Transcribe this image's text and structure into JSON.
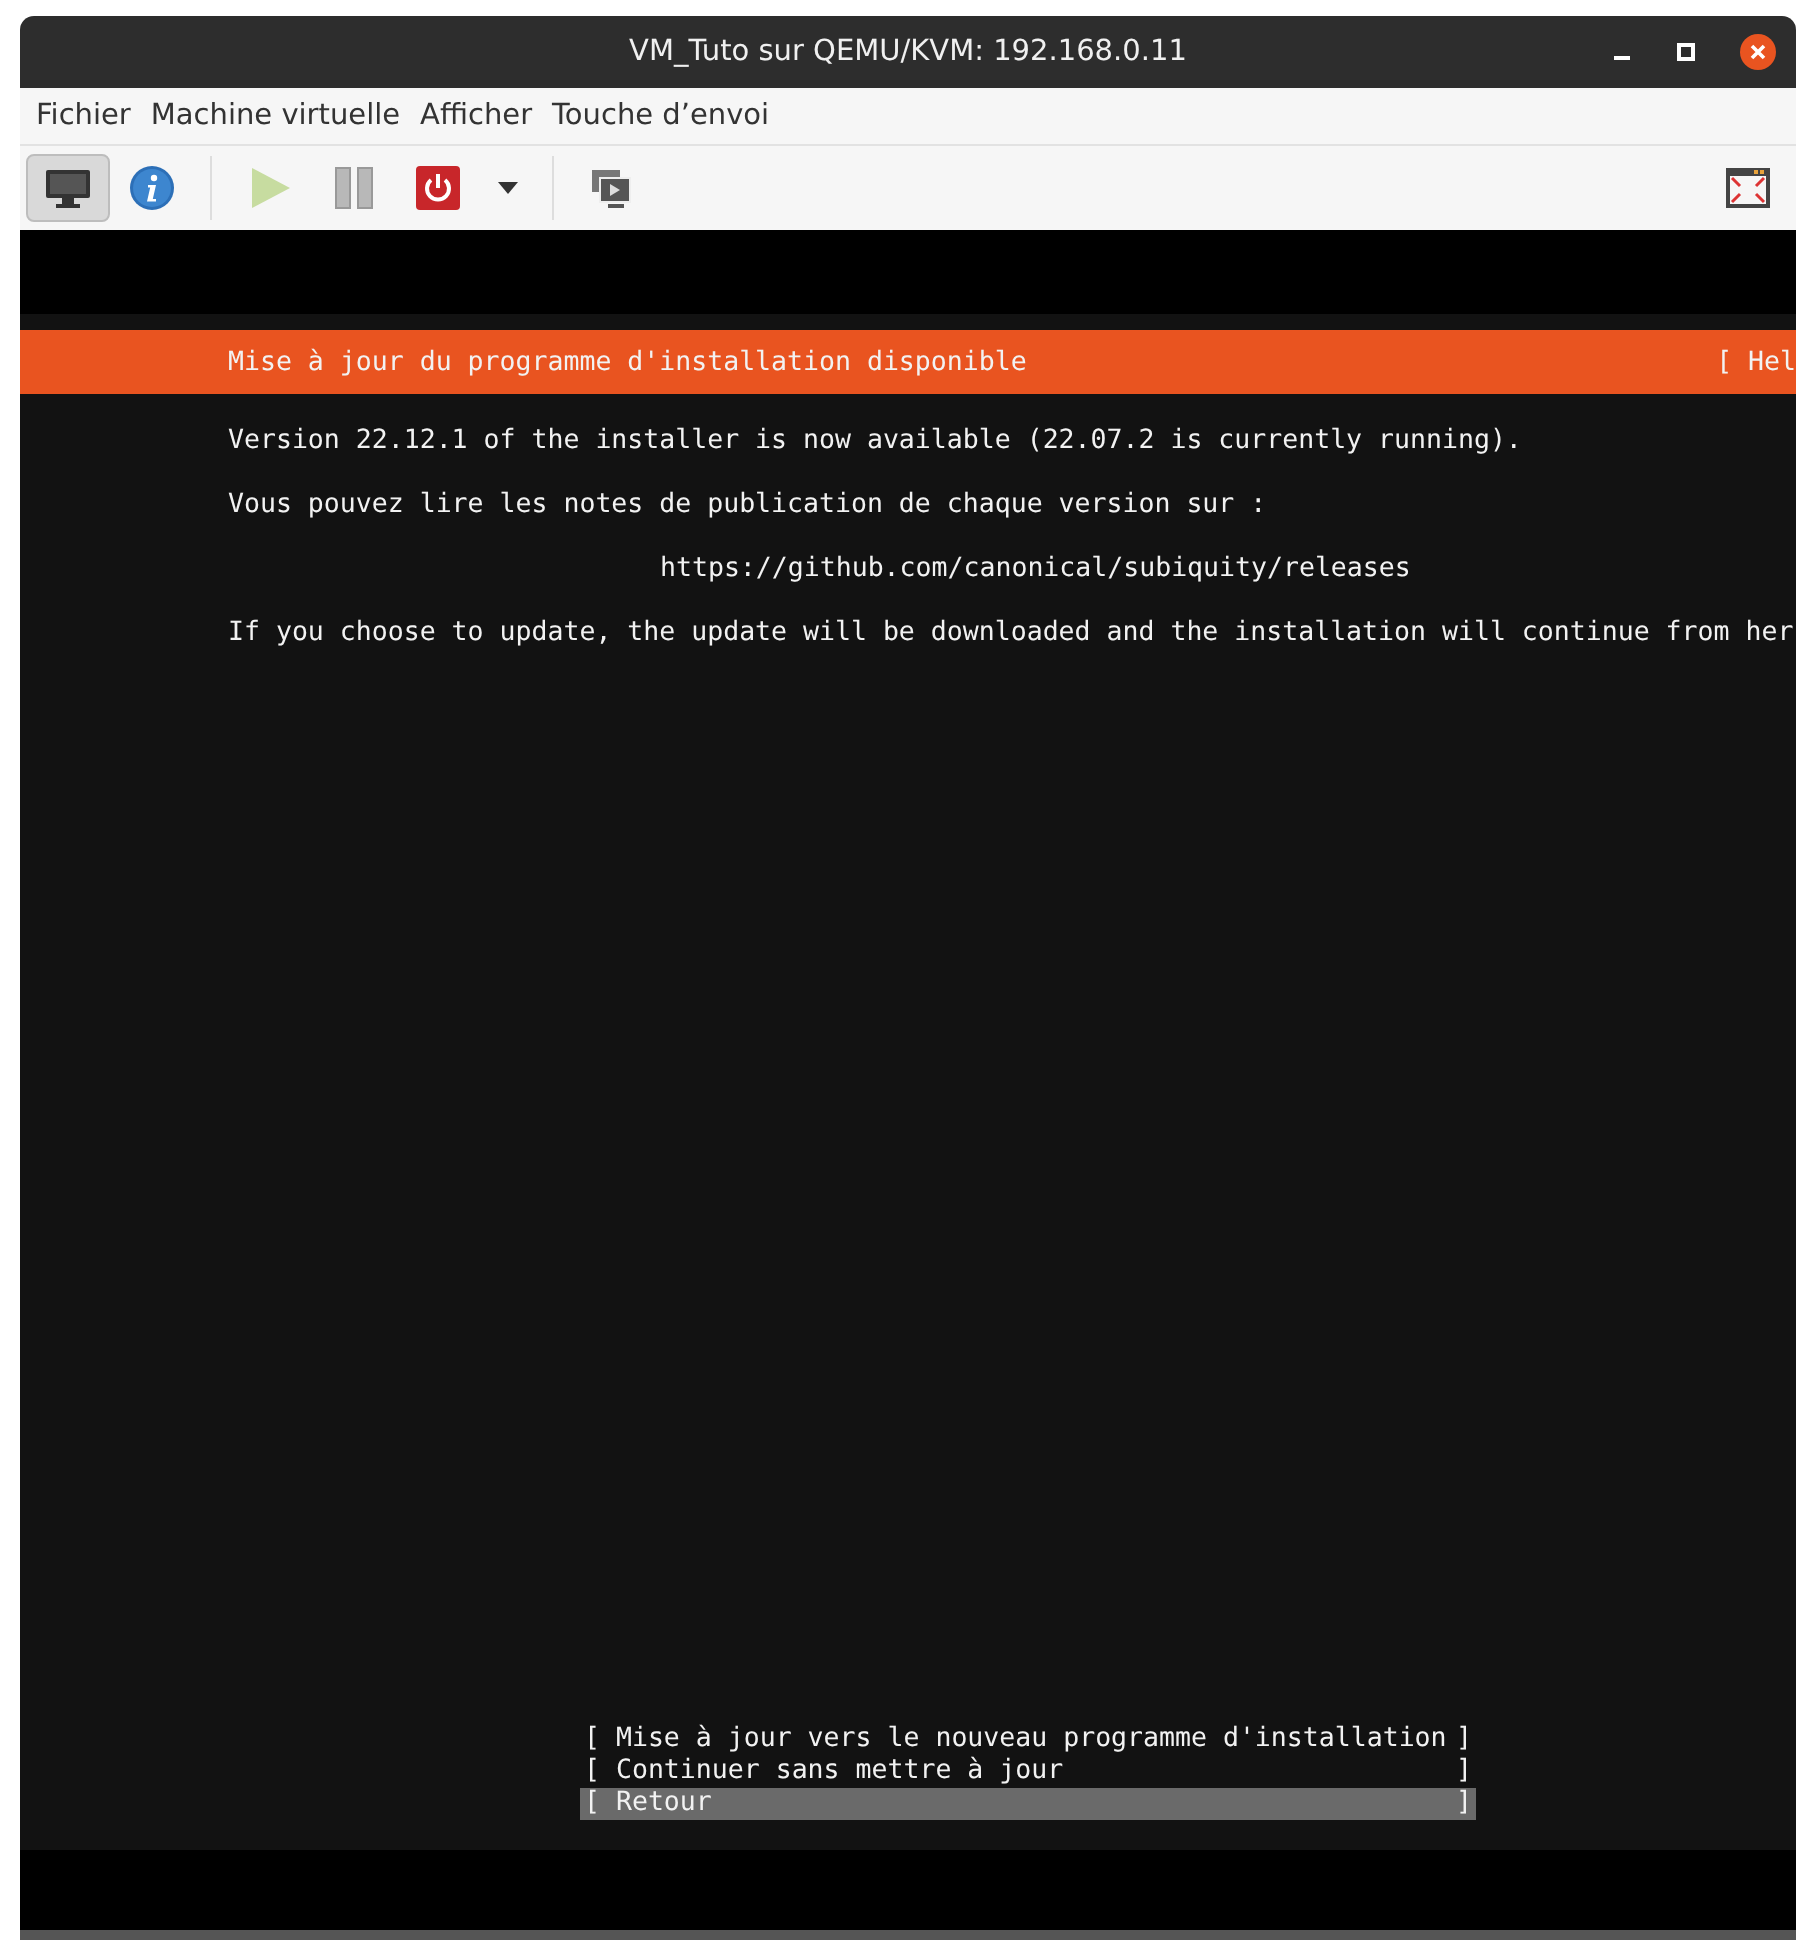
{
  "window": {
    "title": "VM_Tuto sur QEMU/KVM: 192.168.0.11"
  },
  "menu": [
    "Fichier",
    "Machine virtuelle",
    "Afficher",
    "Touche d’envoi"
  ],
  "toolbar": [
    {
      "kind": "console",
      "selected": true
    },
    {
      "kind": "details",
      "selected": false
    },
    {
      "kind": "sep"
    },
    {
      "kind": "run",
      "selected": false,
      "disabled": true
    },
    {
      "kind": "pause",
      "selected": false,
      "disabled": false
    },
    {
      "kind": "power",
      "selected": false
    },
    {
      "kind": "dropdown",
      "selected": false
    },
    {
      "kind": "sep"
    },
    {
      "kind": "snapshots",
      "selected": false
    },
    {
      "kind": "spacer"
    },
    {
      "kind": "fullscreen",
      "selected": false
    }
  ],
  "installer": {
    "header": {
      "title": "Mise à jour du programme d'installation disponible",
      "help": "[ Hel"
    },
    "lines": [
      {
        "text": "Version 22.12.1 of the installer is now available (22.07.2 is currently running).",
        "indented": false
      },
      {
        "text": "Vous pouvez lire les notes de publication de chaque version sur :",
        "indented": false
      },
      {
        "text": "https://github.com/canonical/subiquity/releases",
        "indented": true
      },
      {
        "text": "If you choose to update, the update will be downloaded and the installation will continue from her",
        "indented": false
      }
    ],
    "options": [
      {
        "left": "[",
        "label": "Mise à jour vers le nouveau programme d'installation",
        "right": "]",
        "selected": false
      },
      {
        "left": "[",
        "label": "Continuer sans mettre à jour",
        "right": "]",
        "selected": false
      },
      {
        "left": "[",
        "label": "Retour",
        "right": "]",
        "selected": true
      }
    ]
  }
}
